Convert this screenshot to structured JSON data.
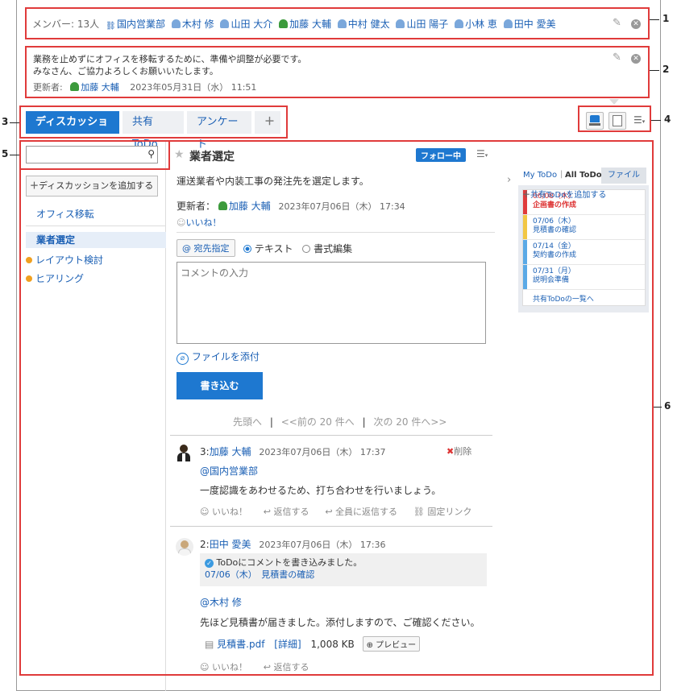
{
  "members": {
    "count_label": "メンバー: 13人",
    "list": [
      {
        "name": "国内営業部",
        "type": "org"
      },
      {
        "name": "木村 修",
        "type": "user"
      },
      {
        "name": "山田 大介",
        "type": "user"
      },
      {
        "name": "加藤 大輔",
        "type": "user-green"
      },
      {
        "name": "中村 健太",
        "type": "user"
      },
      {
        "name": "山田 陽子",
        "type": "user"
      },
      {
        "name": "小林 恵",
        "type": "user"
      },
      {
        "name": "田中 愛美",
        "type": "user"
      }
    ]
  },
  "description": {
    "line1": "業務を止めずにオフィスを移転するために、準備や調整が必要です。",
    "line2": "みなさん、ご協力よろしくお願いいたします。",
    "updater_label": "更新者:",
    "updater_name": "加藤 大輔",
    "updated_at": "2023年05月31日（水） 11:51"
  },
  "tabs": [
    {
      "label": "ディスカッション",
      "active": true
    },
    {
      "label": "共有ToDo",
      "active": false
    },
    {
      "label": "アンケート",
      "active": false
    },
    {
      "label": "＋",
      "active": false
    }
  ],
  "sidebar": {
    "search_placeholder": "",
    "add_label": "ディスカッションを追加する",
    "items": [
      {
        "label": "オフィス移転",
        "selected": false,
        "badge": false
      },
      {
        "label": "業者選定",
        "selected": true,
        "badge": false
      },
      {
        "label": "レイアウト検討",
        "selected": false,
        "badge": true
      },
      {
        "label": "ヒアリング",
        "selected": false,
        "badge": true
      }
    ]
  },
  "thread": {
    "title": "業者選定",
    "follow_label": "フォロー中",
    "body": "運送業者や内装工事の発注先を選定します。",
    "updater_label": "更新者：",
    "updater_name": "加藤 大輔",
    "updated_at": "2023年07月06日（木） 17:34",
    "like_label": "いいね！"
  },
  "composer": {
    "mention_label": "宛先指定",
    "radio_text": "テキスト",
    "radio_rich": "書式編集",
    "placeholder": "コメントの入力",
    "attach_label": "ファイルを添付",
    "submit_label": "書き込む"
  },
  "pager": {
    "first": "先頭へ",
    "prev": "<<前の 20 件へ",
    "next": "次の 20 件へ>>",
    "sep": "|"
  },
  "comments": [
    {
      "num": "3:",
      "author": "加藤 大輔",
      "time": "2023年07月06日（木） 17:37",
      "delete_label": "削除",
      "mention": "@国内営業部",
      "text": "一度認識をあわせるため、打ち合わせを行いましょう。",
      "actions": [
        "いいね！",
        "返信する",
        "全員に返信する",
        "固定リンク"
      ]
    },
    {
      "num": "2:",
      "author": "田中 愛美",
      "time": "2023年07月06日（木） 17:36",
      "todo_note": "ToDoにコメントを書き込みました。",
      "todo_link": "07/06（木）　見積書の確認",
      "mention": "@木村 修",
      "text": "先ほど見積書が届きました。添付しますので、ご確認ください。",
      "file_name": "見積書.pdf",
      "file_detail": "[詳細]",
      "file_size": "1,008 KB",
      "preview_label": "プレビュー",
      "actions": [
        "いいね！",
        "返信する"
      ]
    }
  ],
  "todo_panel": {
    "tabs": [
      "My ToDo",
      "All ToDo",
      "ファイル"
    ],
    "add_label": "共有ToDoを追加する",
    "items": [
      {
        "date": "06/08（木）",
        "title": "企画書の作成",
        "color": "#e03b3b",
        "overdue": true
      },
      {
        "date": "07/06（木）",
        "title": "見積書の確認",
        "color": "#f2c744",
        "overdue": false
      },
      {
        "date": "07/14（金）",
        "title": "契約書の作成",
        "color": "#5aa9e6",
        "overdue": false
      },
      {
        "date": "07/31（月）",
        "title": "説明会準備",
        "color": "#5aa9e6",
        "overdue": false
      }
    ],
    "list_link": "共有ToDoの一覧へ"
  },
  "callouts": [
    "1",
    "2",
    "3",
    "4",
    "5",
    "6"
  ],
  "colors": {
    "accent": "#1e78d0",
    "annotation": "#e03b3b",
    "link": "#1a5fb4"
  }
}
